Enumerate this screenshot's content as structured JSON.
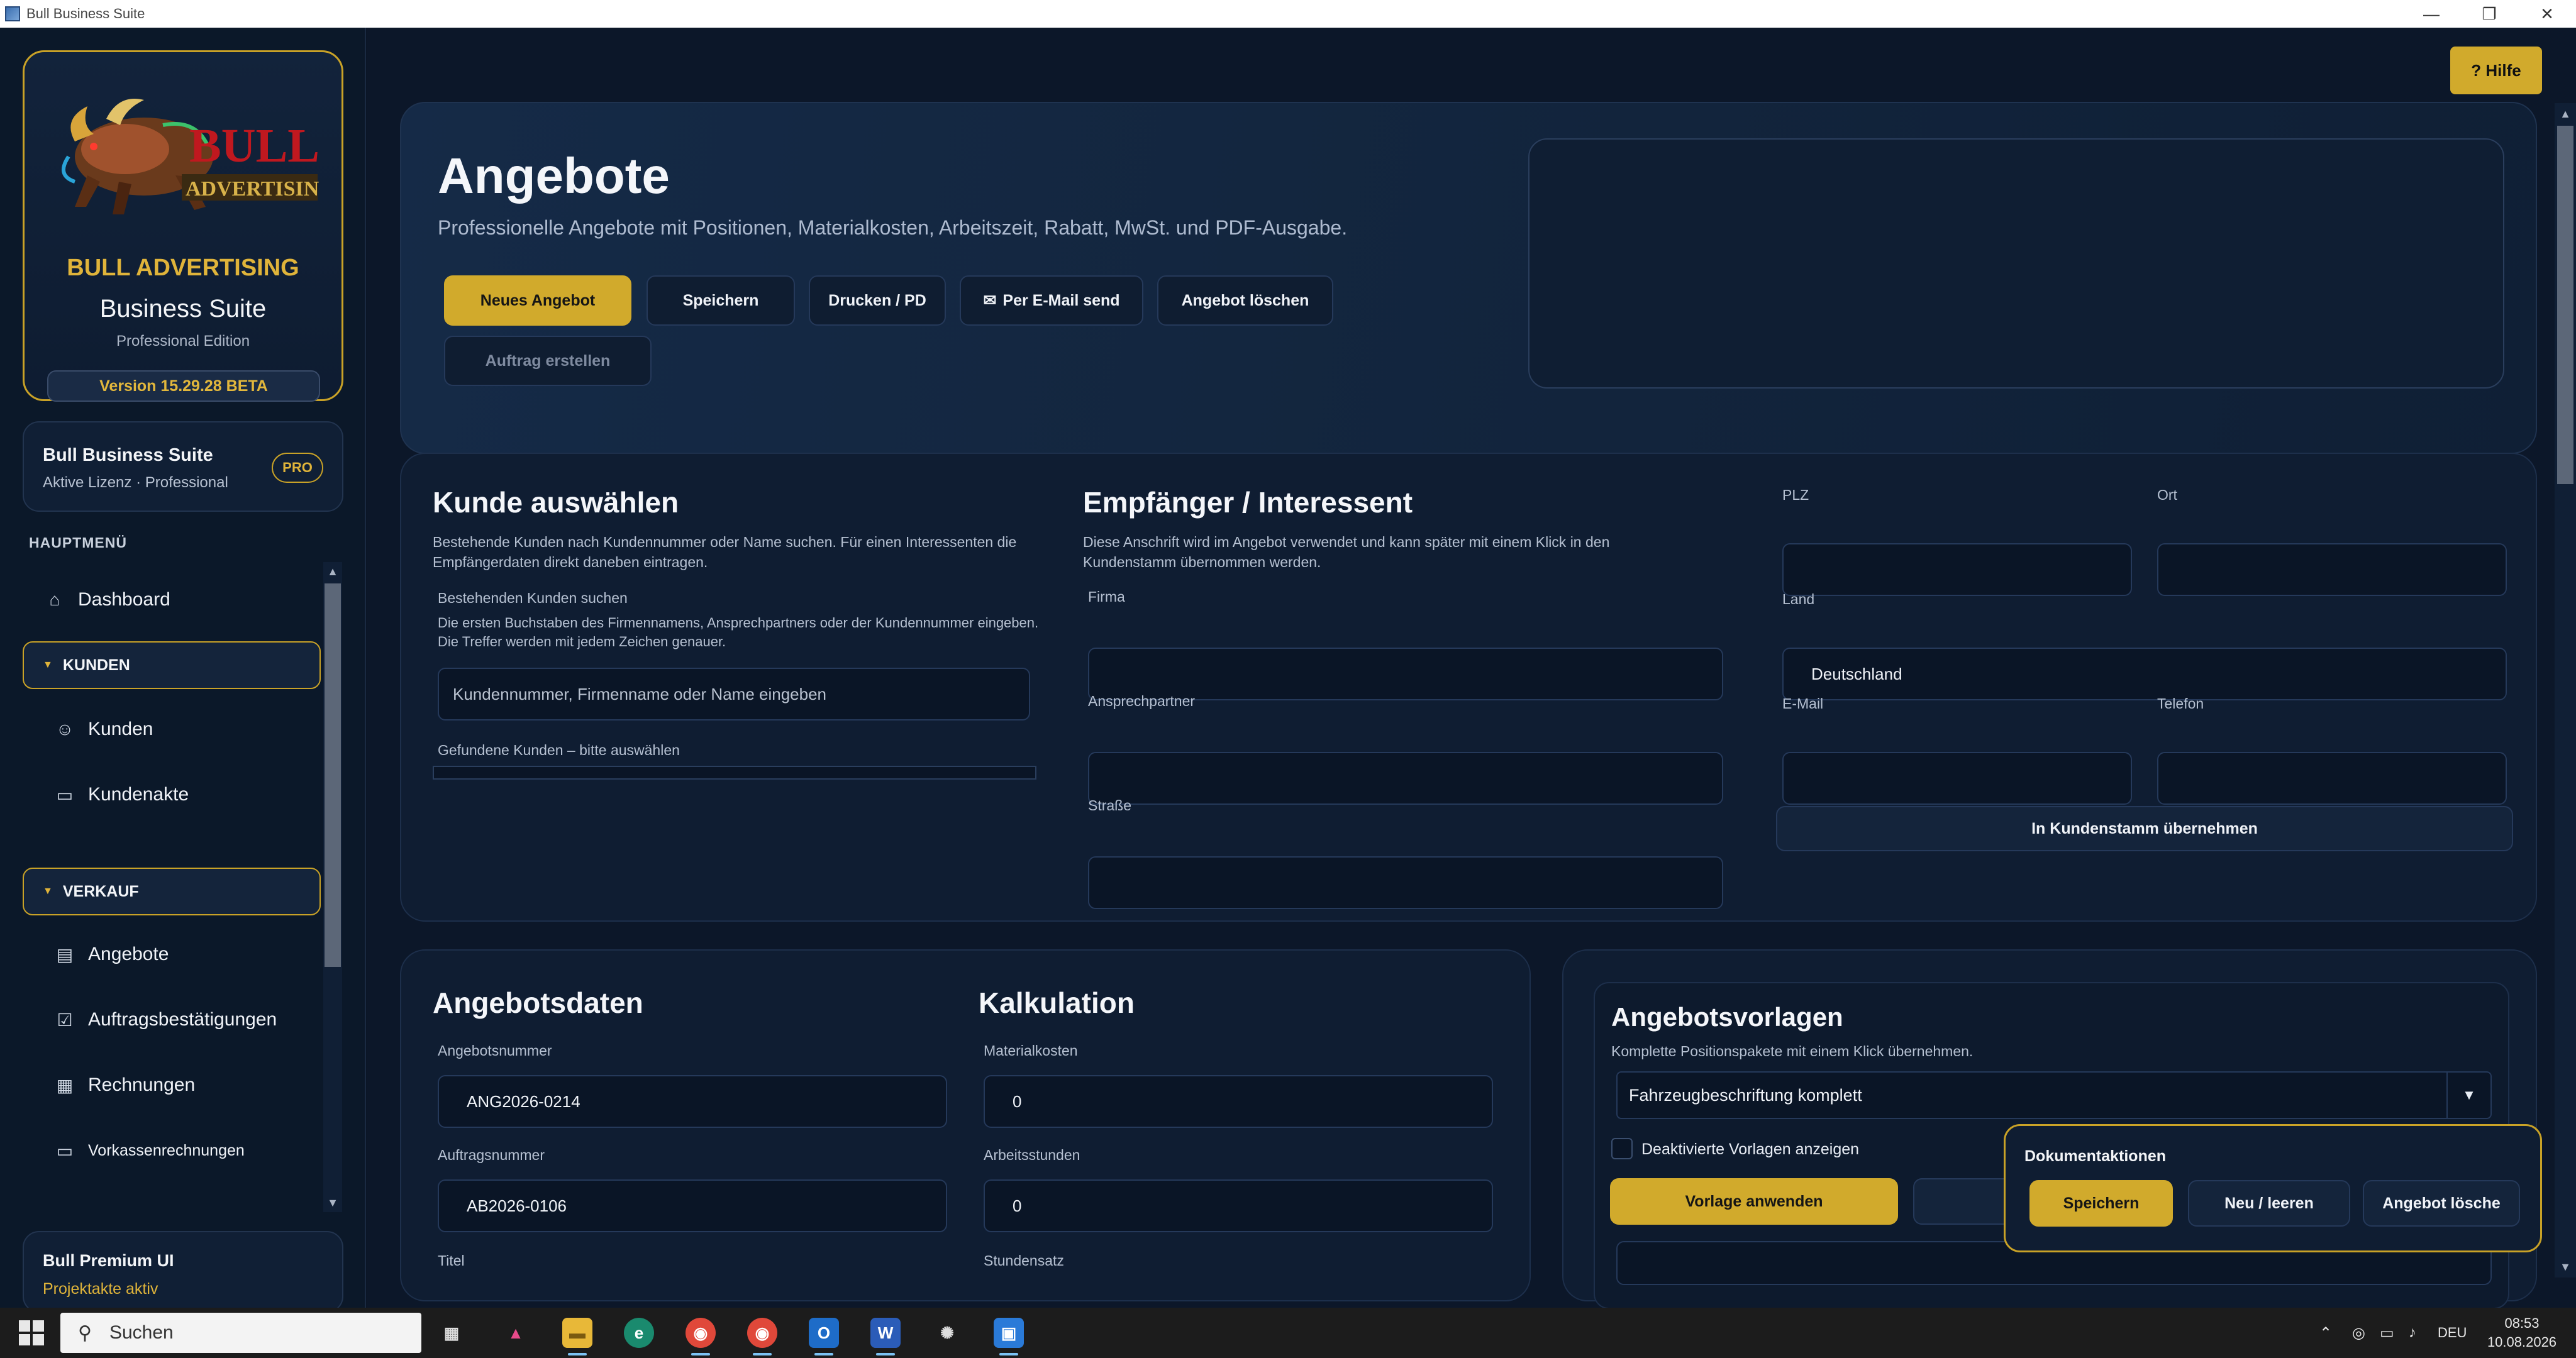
{
  "window": {
    "title": "Bull Business Suite",
    "controls": {
      "minimize": "—",
      "restore": "❐",
      "close": "✕"
    }
  },
  "sidebar": {
    "brand": {
      "logo_text_top": "BULL",
      "logo_text_bottom": "ADVERTISING",
      "name": "BULL ADVERTISING",
      "suite": "Business Suite",
      "edition": "Professional Edition",
      "version": "Version 15.29.28 BETA"
    },
    "license": {
      "title": "Bull Business Suite",
      "subtitle": "Aktive Lizenz · Professional",
      "badge": "PRO"
    },
    "menu_heading": "HAUPTMENÜ",
    "items": {
      "dashboard": "Dashboard",
      "group_kunden": "KUNDEN",
      "kunden": "Kunden",
      "kundenakte": "Kundenakte",
      "group_verkauf": "VERKAUF",
      "angebote": "Angebote",
      "auftragsbestaetigungen": "Auftragsbestätigungen",
      "rechnungen": "Rechnungen",
      "vorkassenrechnungen": "Vorkassenrechnungen"
    },
    "premium": {
      "title": "Bull Premium UI",
      "subtitle": "Projektakte aktiv"
    }
  },
  "header": {
    "help_label": "? Hilfe",
    "title": "Angebote",
    "subtitle": "Professionelle Angebote mit Positionen, Materialkosten, Arbeitszeit, Rabatt, MwSt. und PDF-Ausgabe.",
    "buttons": {
      "new": "Neues Angebot",
      "save": "Speichern",
      "print": "Drucken / PD",
      "email": "Per E-Mail send",
      "delete": "Angebot löschen",
      "create_order": "Auftrag erstellen"
    }
  },
  "customer": {
    "title": "Kunde auswählen",
    "description": "Bestehende Kunden nach Kundennummer oder Name suchen. Für einen Interessenten die Empfängerdaten direkt daneben eintragen.",
    "search_label": "Bestehenden Kunden suchen",
    "search_hint": "Die ersten Buchstaben des Firmennamens, Ansprechpartners oder der Kundennummer eingeben. Die Treffer werden mit jedem Zeichen genauer.",
    "search_placeholder": "Kundennummer, Firmenname oder Name eingeben",
    "results_label": "Gefundene Kunden – bitte auswählen"
  },
  "recipient": {
    "title": "Empfänger / Interessent",
    "description": "Diese Anschrift wird im Angebot verwendet und kann später mit einem Klick in den Kundenstamm übernommen werden.",
    "firma_label": "Firma",
    "firma_value": "",
    "contact_label": "Ansprechpartner",
    "contact_value": "",
    "street_label": "Straße",
    "street_value": "",
    "plz_label": "PLZ",
    "plz_value": "",
    "ort_label": "Ort",
    "ort_value": "",
    "land_label": "Land",
    "land_value": "Deutschland",
    "email_label": "E-Mail",
    "email_value": "",
    "phone_label": "Telefon",
    "phone_value": "",
    "transfer_button": "In Kundenstamm übernehmen"
  },
  "offer_data": {
    "title": "Angebotsdaten",
    "number_label": "Angebotsnummer",
    "number_value": "ANG2026-0214",
    "order_label": "Auftragsnummer",
    "order_value": "AB2026-0106",
    "title_label": "Titel"
  },
  "calculation": {
    "title": "Kalkulation",
    "material_label": "Materialkosten",
    "material_value": "0",
    "hours_label": "Arbeitsstunden",
    "hours_value": "0",
    "rate_label": "Stundensatz"
  },
  "templates": {
    "title": "Angebotsvorlagen",
    "description": "Komplette Positionspakete mit einem Klick übernehmen.",
    "selected": "Fahrzeugbeschriftung komplett",
    "show_disabled_label": "Deaktivierte Vorlagen anzeigen",
    "apply_button": "Vorlage anwenden"
  },
  "doc_actions": {
    "title": "Dokumentaktionen",
    "save": "Speichern",
    "new": "Neu / leeren",
    "delete": "Angebot lösche"
  },
  "taskbar": {
    "search_placeholder": "Suchen",
    "language": "DEU",
    "time": "08:53",
    "date": "10.08.2026"
  },
  "colors": {
    "accent_gold": "#d1aa2c",
    "background": "#0c1729",
    "card": "#0f1d32"
  }
}
